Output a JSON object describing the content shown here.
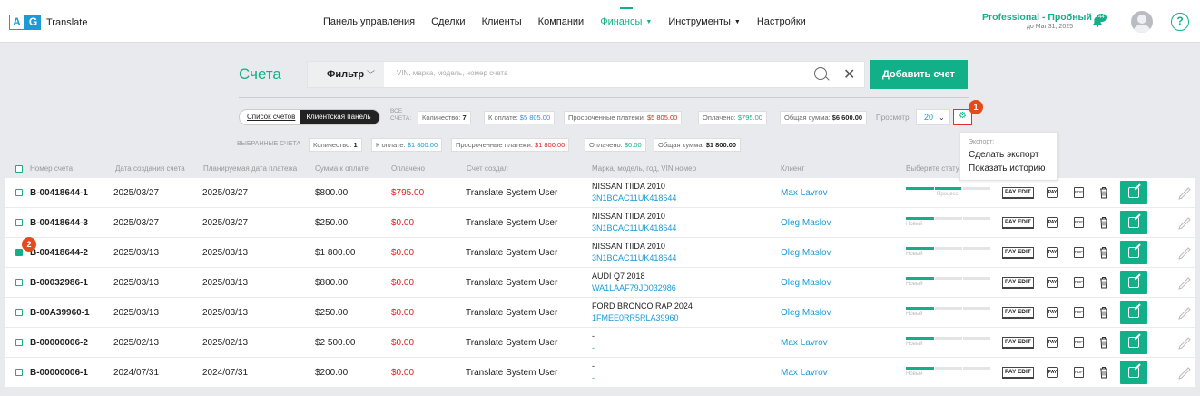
{
  "header": {
    "logo": {
      "letter1": "A",
      "letter2": "G",
      "name": "Translate"
    },
    "nav": [
      {
        "label": "Панель управления"
      },
      {
        "label": "Сделки"
      },
      {
        "label": "Клиенты"
      },
      {
        "label": "Компании"
      },
      {
        "label": "Финансы",
        "active": true,
        "dropdown": true
      },
      {
        "label": "Инструменты",
        "dropdown": true
      },
      {
        "label": "Настройки"
      }
    ],
    "plan": {
      "title": "Professional - Пробный",
      "subtitle": "до Мar 31, 2025"
    },
    "notifications_count": "44",
    "help_label": "?"
  },
  "page": {
    "title": "Счета",
    "filter_label": "Фильтр",
    "search_placeholder": "VIN, марка, модель, номер счета",
    "add_button": "Добавить счет"
  },
  "tabs": {
    "list": "Список счетов",
    "client": "Клиентская панель"
  },
  "all_label": "ВСЕ СЧЕТА:",
  "all_stats": {
    "count_label": "Количество:",
    "count": "7",
    "topay_label": "К оплате:",
    "topay": "$5 805.00",
    "overdue_label": "Просроченные платежи:",
    "overdue": "$5 805.00",
    "paid_label": "Оплачено:",
    "paid": "$795.00",
    "total_label": "Общая сумма:",
    "total": "$6 600.00"
  },
  "selected_label": "ВЫБРАННЫЕ СЧЕТА",
  "selected_stats": {
    "count_label": "Количество:",
    "count": "1",
    "topay_label": "К оплате:",
    "topay": "$1 800.00",
    "overdue_label": "Просроченные платежи:",
    "overdue": "$1 800.00",
    "paid_label": "Оплачено:",
    "paid": "$0.00",
    "total_label": "Общая сумма:",
    "total": "$1 800.00"
  },
  "view_label": "Просмотр",
  "per_page": "20",
  "export_menu": {
    "header": "Экспорт:",
    "items": [
      "Сделать экспорт",
      "Показать историю"
    ]
  },
  "annotations": [
    "1",
    "2"
  ],
  "columns": [
    "Номер счета",
    "Дата создания счета",
    "Планируемая дата платежа",
    "Сумма к оплате",
    "Оплачено",
    "Счет создал",
    "Марка, модель, год, VIN номер",
    "Клиент",
    "Выберите статус"
  ],
  "rows": [
    {
      "num": "B-00418644-1",
      "created": "2025/03/27",
      "planned": "2025/03/27",
      "amount": "$800.00",
      "paid": "$795.00",
      "by": "Translate System User",
      "car": "NISSAN TIIDA 2010",
      "vin": "3N1BCAC11UK418644",
      "client": "Max Lavrov",
      "status": "Процесс",
      "progress": 0.66
    },
    {
      "num": "B-00418644-3",
      "created": "2025/03/27",
      "planned": "2025/03/27",
      "amount": "$250.00",
      "paid": "$0.00",
      "by": "Translate System User",
      "car": "NISSAN TIIDA 2010",
      "vin": "3N1BCAC11UK418644",
      "client": "Oleg Maslov",
      "status": "Новый",
      "progress": 0.33
    },
    {
      "num": "B-00418644-2",
      "created": "2025/03/13",
      "planned": "2025/03/13",
      "amount": "$1 800.00",
      "paid": "$0.00",
      "by": "Translate System User",
      "car": "NISSAN TIIDA 2010",
      "vin": "3N1BCAC11UK418644",
      "client": "Oleg Maslov",
      "status": "Новый",
      "progress": 0.33,
      "selected": true
    },
    {
      "num": "B-00032986-1",
      "created": "2025/03/13",
      "planned": "2025/03/13",
      "amount": "$800.00",
      "paid": "$0.00",
      "by": "Translate System User",
      "car": "AUDI Q7 2018",
      "vin": "WA1LAAF79JD032986",
      "client": "Oleg Maslov",
      "status": "Новый",
      "progress": 0.33
    },
    {
      "num": "B-00A39960-1",
      "created": "2025/03/13",
      "planned": "2025/03/13",
      "amount": "$250.00",
      "paid": "$0.00",
      "by": "Translate System User",
      "car": "FORD BRONCO RAP 2024",
      "vin": "1FMEE0RR5RLA39960",
      "client": "Oleg Maslov",
      "status": "Новый",
      "progress": 0.33
    },
    {
      "num": "B-00000006-2",
      "created": "2025/02/13",
      "planned": "2025/02/13",
      "amount": "$2 500.00",
      "paid": "$0.00",
      "by": "Translate System User",
      "car": "-",
      "vin": "-",
      "client": "Max Lavrov",
      "status": "Новый",
      "progress": 0.33
    },
    {
      "num": "B-00000006-1",
      "created": "2024/07/31",
      "planned": "2024/07/31",
      "amount": "$200.00",
      "paid": "$0.00",
      "by": "Translate System User",
      "car": "-",
      "vin": "-",
      "client": "Max Lavrov",
      "status": "Новый",
      "progress": 0.33
    }
  ],
  "row_actions": {
    "pay_edit": "PAY EDIT",
    "pay": "PAY",
    "pdf": "PDF"
  },
  "colors": {
    "accent": "#12b089",
    "link": "#1b9ad6",
    "danger": "#e02020",
    "highlight": "#e64a19"
  }
}
